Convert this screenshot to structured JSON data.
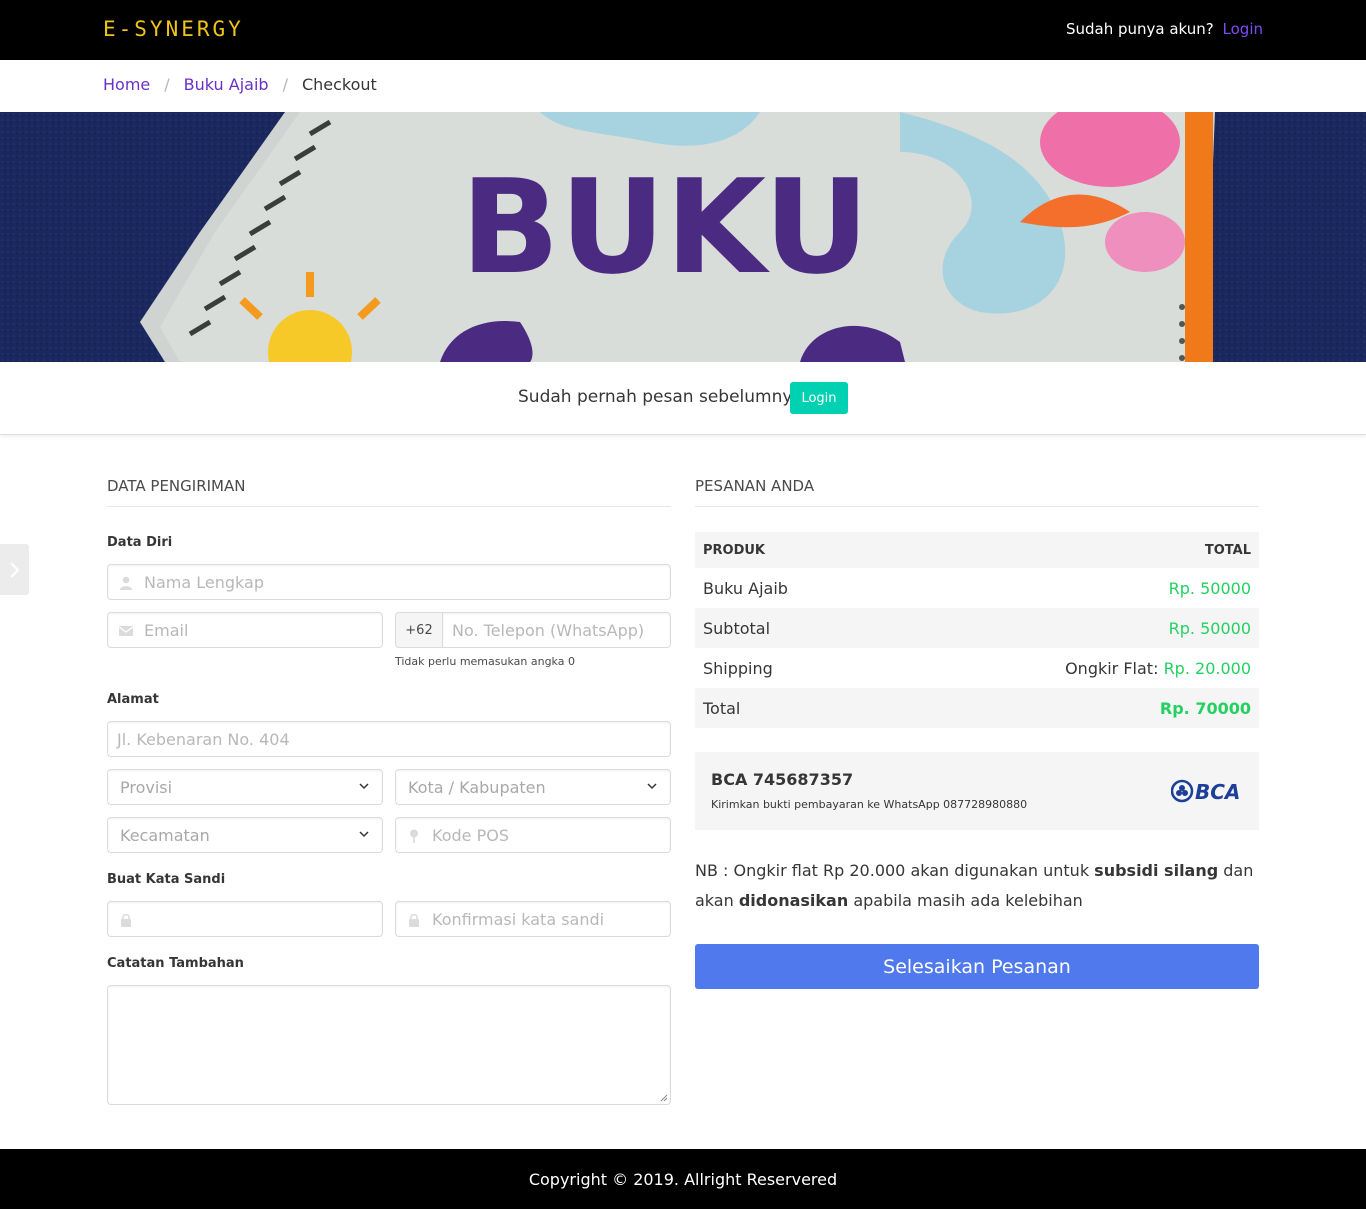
{
  "nav": {
    "brand": "E-SYNERGY",
    "account_prompt": "Sudah punya akun?",
    "login_label": "Login"
  },
  "breadcrumb": [
    {
      "label": "Home"
    },
    {
      "label": "Buku Ajaib"
    },
    {
      "label": "Checkout"
    }
  ],
  "breadcrumb_separator": "/",
  "hero": {
    "title_text": "BUKU",
    "alt": "Buku Ajaib cover"
  },
  "login_strip": {
    "prompt": "Sudah pernah pesan sebelumnya?",
    "button": "Login"
  },
  "shipping": {
    "title": "DATA PENGIRIMAN",
    "personal_label": "Data Diri",
    "full_name_placeholder": "Nama Lengkap",
    "email_placeholder": "Email",
    "phone_prefix": "+62",
    "phone_placeholder": "No. Telepon (WhatsApp)",
    "phone_help": "Tidak perlu memasukan angka 0",
    "address_label": "Alamat",
    "address_placeholder": "Jl. Kebenaran No. 404",
    "province_placeholder": "Provisi",
    "city_placeholder": "Kota / Kabupaten",
    "district_placeholder": "Kecamatan",
    "postal_placeholder": "Kode POS",
    "password_label": "Buat Kata Sandi",
    "password_placeholder": "",
    "confirm_password_placeholder": "Konfirmasi kata sandi",
    "notes_label": "Catatan Tambahan"
  },
  "order": {
    "title": "PESANAN ANDA",
    "col_product": "PRODUK",
    "col_total": "TOTAL",
    "rows": [
      {
        "label": "Buku Ajaib",
        "value": "Rp. 50000"
      },
      {
        "label": "Subtotal",
        "value": "Rp. 50000"
      },
      {
        "label": "Shipping",
        "value_prefix": "Ongkir Flat:",
        "value": "Rp. 20.000"
      },
      {
        "label": "Total",
        "value": "Rp. 70000"
      }
    ]
  },
  "payment": {
    "account": "BCA 745687357",
    "instruction": "Kirimkan bukti pembayaran ke WhatsApp 087728980880",
    "bank_logo_text": "BCA"
  },
  "note": {
    "part1": "NB : Ongkir flat Rp 20.000 akan digunakan untuk ",
    "bold1": "subsidi silang",
    "part2": " dan akan ",
    "bold2": "didonasikan",
    "part3": " apabila masih ada kelebihan"
  },
  "submit_label": "Selesaikan Pesanan",
  "footer": "Copyright © 2019. Allright Reservered",
  "colors": {
    "accent_purple": "#6a30c9",
    "turquoise": "#00d1b2",
    "green": "#23d160",
    "button_blue": "#4f79ec",
    "brand_gold": "#f0c419"
  }
}
